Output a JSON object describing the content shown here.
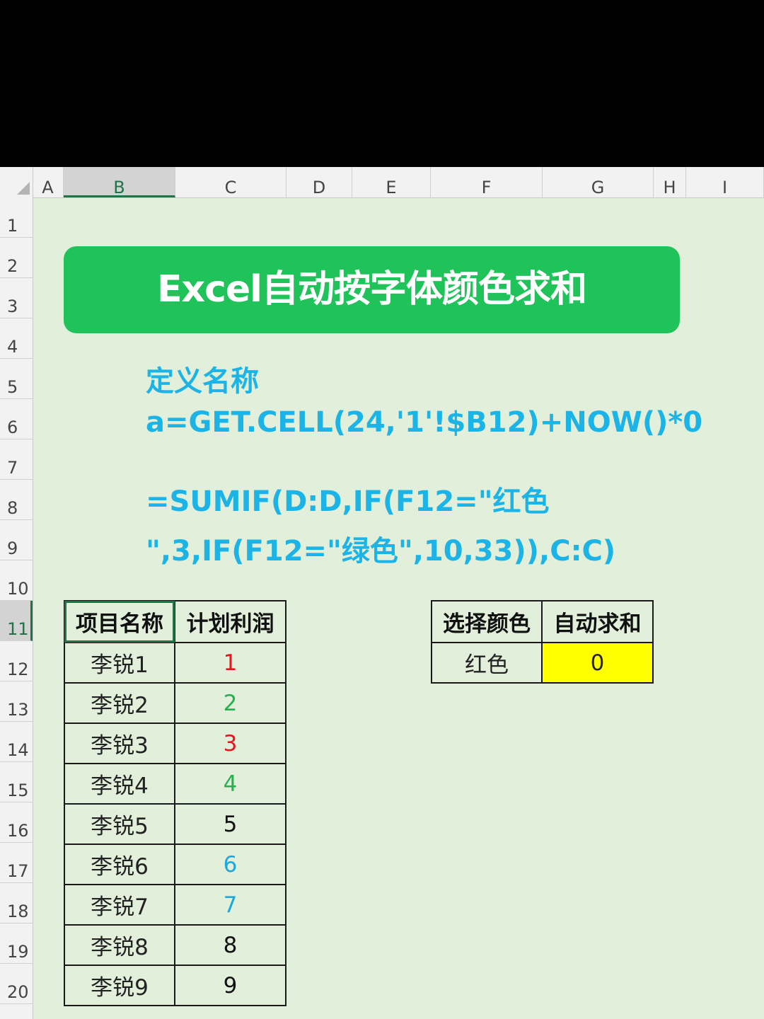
{
  "columns": [
    "A",
    "B",
    "C",
    "D",
    "E",
    "F",
    "G",
    "H",
    "I"
  ],
  "rows": [
    "1",
    "2",
    "3",
    "4",
    "5",
    "6",
    "7",
    "8",
    "9",
    "10",
    "11",
    "12",
    "13",
    "14",
    "15",
    "16",
    "17",
    "18",
    "19",
    "20"
  ],
  "banner": {
    "title": "Excel自动按字体颜色求和"
  },
  "notes": {
    "heading": "定义名称",
    "define_formula": "a=GET.CELL(24,'1'!$B12)+NOW()*0",
    "sum_formula_line1": "=SUMIF(D:D,IF(F12=\"红色",
    "sum_formula_line2": "\",3,IF(F12=\"绿色\",10,33)),C:C)"
  },
  "left_table": {
    "headers": [
      "项目名称",
      "计划利润"
    ],
    "rows": [
      {
        "name": "李锐1",
        "profit": "1",
        "color": "#e8141e"
      },
      {
        "name": "李锐2",
        "profit": "2",
        "color": "#22b24c"
      },
      {
        "name": "李锐3",
        "profit": "3",
        "color": "#e8141e"
      },
      {
        "name": "李锐4",
        "profit": "4",
        "color": "#22b24c"
      },
      {
        "name": "李锐5",
        "profit": "5",
        "color": "#111111"
      },
      {
        "name": "李锐6",
        "profit": "6",
        "color": "#1ba8e0"
      },
      {
        "name": "李锐7",
        "profit": "7",
        "color": "#1ba8e0"
      },
      {
        "name": "李锐8",
        "profit": "8",
        "color": "#111111"
      },
      {
        "name": "李锐9",
        "profit": "9",
        "color": "#111111"
      }
    ]
  },
  "right_table": {
    "headers": [
      "选择颜色",
      "自动求和"
    ],
    "color_value": "红色",
    "sum_value": "0",
    "sum_bg": "#ffff00"
  }
}
